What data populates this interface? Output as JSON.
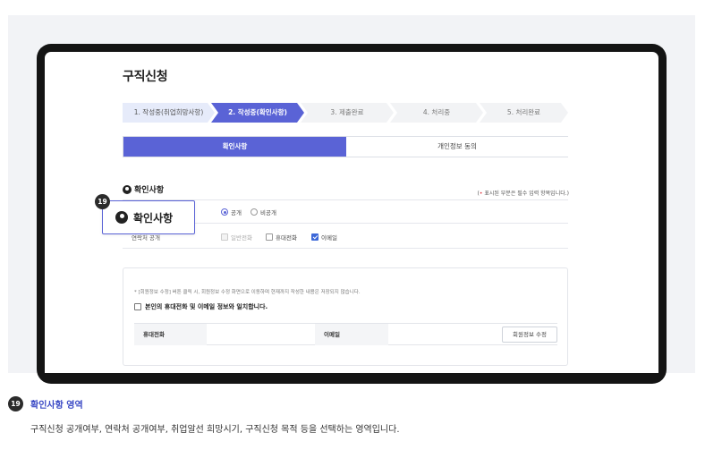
{
  "page_title": "구직신청",
  "steps": [
    {
      "label": "1. 작성중(취업희망사항)",
      "state": "done"
    },
    {
      "label": "2. 작성중(확인사항)",
      "state": "active"
    },
    {
      "label": "3. 제출완료",
      "state": "todo"
    },
    {
      "label": "4. 처리중",
      "state": "todo"
    },
    {
      "label": "5. 처리완료",
      "state": "todo"
    }
  ],
  "tabs": {
    "active": "확인사항",
    "inactive": "개인정보 동의"
  },
  "section": {
    "title": "확인사항",
    "required_mark": "•",
    "required_note": "표시된 부분은 필수 입력 항목입니다."
  },
  "open_row": {
    "public": "공개",
    "private": "비공개",
    "selected": "공개"
  },
  "contact_row": {
    "label": "연락처 공개",
    "options": [
      {
        "label": "일반전화",
        "checked": false,
        "disabled": true
      },
      {
        "label": "휴대전화",
        "checked": false,
        "disabled": false
      },
      {
        "label": "이메일",
        "checked": true,
        "disabled": false
      }
    ]
  },
  "info_card": {
    "note": "* [회원정보 수정] 버튼 클릭 시, 회원정보 수정 화면으로 이동하며 현재까지 작성한 내용은 저장되지 않습니다.",
    "confirm_label": "본인의 휴대전화 및 이메일 정보와 일치합니다.",
    "phone_label": "휴대전화",
    "email_label": "이메일",
    "edit_button": "회원정보 수정"
  },
  "callout": {
    "number": "19",
    "label": "확인사항"
  },
  "description": {
    "number": "19",
    "title": "확인사항 영역",
    "text": "구직신청 공개여부, 연락처 공개여부, 취업알선 희망시기, 구직신청 목적 등을 선택하는 영역입니다."
  },
  "colors": {
    "accent": "#5a63d6",
    "required": "#e0323c",
    "desc_title": "#3847c4"
  }
}
